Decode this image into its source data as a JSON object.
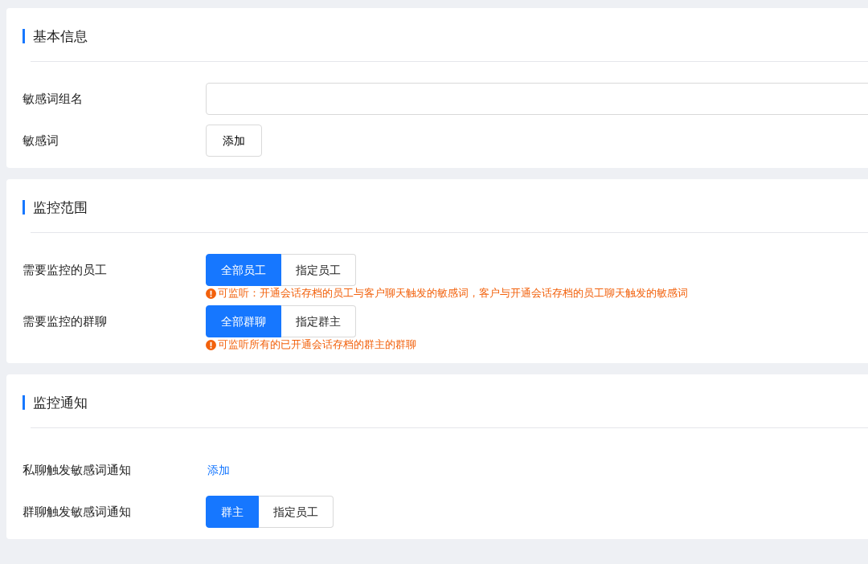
{
  "sections": [
    {
      "title": "基本信息",
      "rows": [
        {
          "kind": "input",
          "label": "敏感词组名"
        },
        {
          "kind": "button",
          "label": "敏感词",
          "button": "添加"
        }
      ]
    },
    {
      "title": "监控范围",
      "rows": [
        {
          "kind": "segmented",
          "label": "需要监控的员工",
          "options": [
            {
              "label": "全部员工",
              "selected": true
            },
            {
              "label": "指定员工",
              "selected": false
            }
          ],
          "hint": "可监听：开通会话存档的员工与客户聊天触发的敏感词，客户与开通会话存档的员工聊天触发的敏感词"
        },
        {
          "kind": "segmented",
          "label": "需要监控的群聊",
          "options": [
            {
              "label": "全部群聊",
              "selected": true
            },
            {
              "label": "指定群主",
              "selected": false
            }
          ],
          "hint": "可监听所有的已开通会话存档的群主的群聊"
        }
      ]
    },
    {
      "title": "监控通知",
      "rows": [
        {
          "kind": "link",
          "label": "私聊触发敏感词通知",
          "link": "添加"
        },
        {
          "kind": "segmented",
          "label": "群聊触发敏感词通知",
          "options": [
            {
              "label": "群主",
              "selected": true
            },
            {
              "label": "指定员工",
              "selected": false
            }
          ]
        }
      ]
    }
  ]
}
